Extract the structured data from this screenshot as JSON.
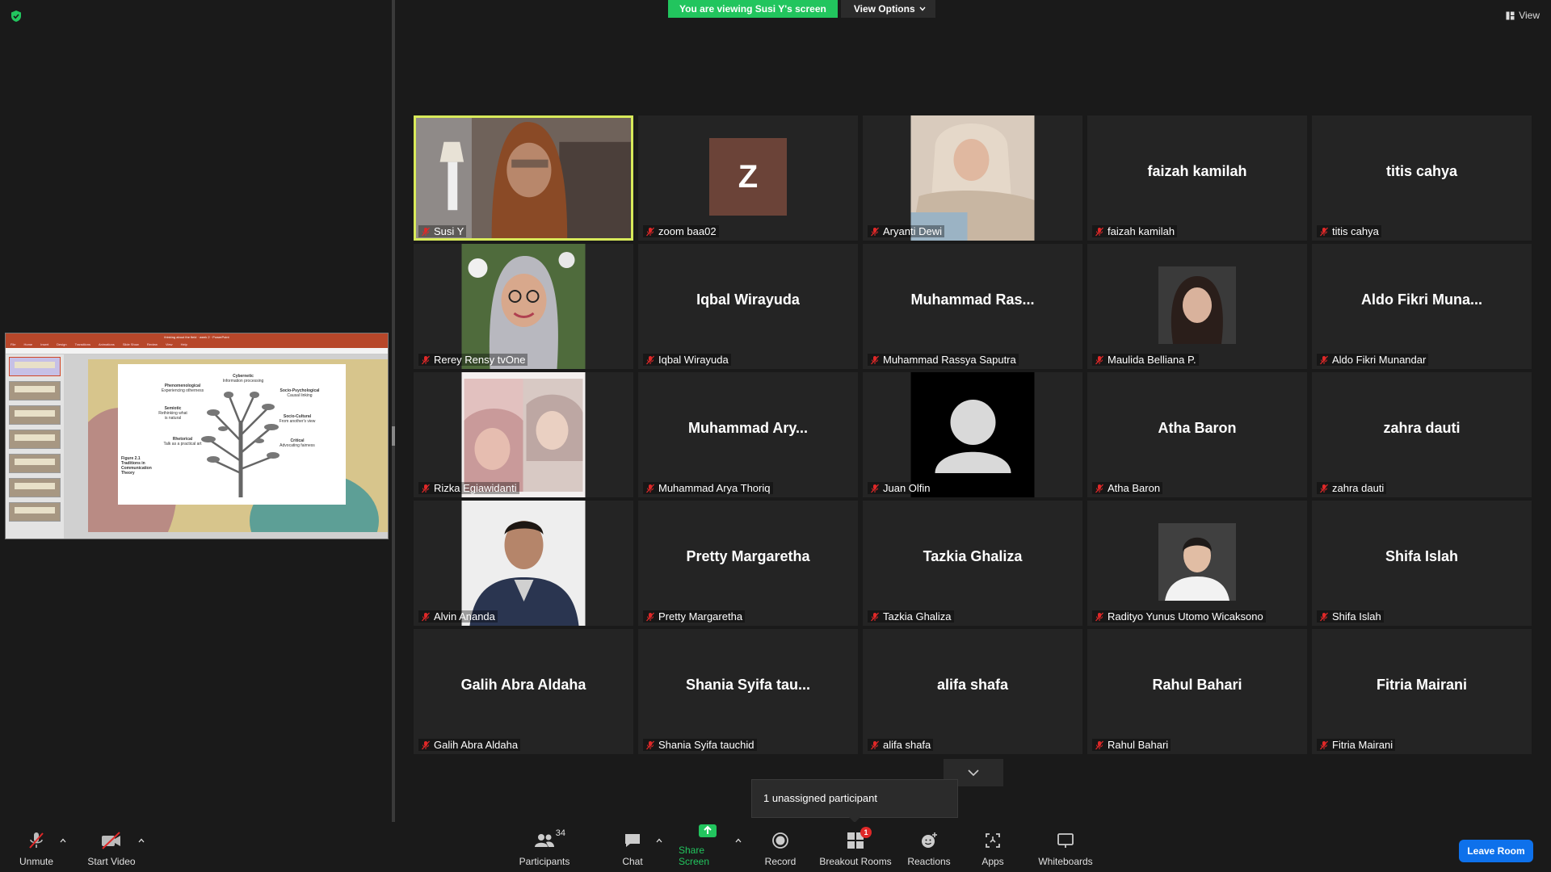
{
  "banner": {
    "viewing": "You are viewing Susi Y's screen",
    "view_options": "View Options"
  },
  "top_right": {
    "view": "View"
  },
  "presentation": {
    "window_title": "thinking about the field · week 2 · PowerPoint",
    "tabs": [
      "File",
      "Home",
      "Insert",
      "Design",
      "Transitions",
      "Animations",
      "Slide Show",
      "Review",
      "View",
      "Help"
    ],
    "slide_labels": [
      {
        "title": "Cybernetic",
        "sub": "Information processing"
      },
      {
        "title": "Phenomenological",
        "sub": "Experiencing otherness"
      },
      {
        "title": "Socio-Psychological",
        "sub": "Causal linking"
      },
      {
        "title": "Semiotic",
        "sub": "Rethinking what is natural"
      },
      {
        "title": "Socio-Cultural",
        "sub": "From another's view"
      },
      {
        "title": "Rhetorical",
        "sub": "Talk as a practical art"
      },
      {
        "title": "Critical",
        "sub": "Advocating fairness"
      }
    ],
    "figure_caption": "Figure 2.1 Traditions in Communication Theory"
  },
  "participants": [
    {
      "name": "Susi Y",
      "display": "",
      "kind": "video"
    },
    {
      "name": "zoom baa02",
      "display": "",
      "kind": "letter",
      "letter": "Z"
    },
    {
      "name": "Aryanti Dewi",
      "display": "",
      "kind": "photo"
    },
    {
      "name": "faizah kamilah",
      "display": "faizah kamilah",
      "kind": "name"
    },
    {
      "name": "titis cahya",
      "display": "titis cahya",
      "kind": "name"
    },
    {
      "name": "Rerey Rensy tvOne",
      "display": "",
      "kind": "photo"
    },
    {
      "name": "Iqbal Wirayuda",
      "display": "Iqbal Wirayuda",
      "kind": "name"
    },
    {
      "name": "Muhammad Rassya Saputra",
      "display": "Muhammad  Ras...",
      "kind": "name"
    },
    {
      "name": "Maulida Belliana P.",
      "display": "",
      "kind": "photo-small"
    },
    {
      "name": "Aldo Fikri Munandar",
      "display": "Aldo  Fikri  Muna...",
      "kind": "name"
    },
    {
      "name": "Rizka Egiawidanti",
      "display": "",
      "kind": "photo"
    },
    {
      "name": "Muhammad Arya Thoriq",
      "display": "Muhammad  Ary...",
      "kind": "name"
    },
    {
      "name": "Juan Olfin",
      "display": "",
      "kind": "default-avatar"
    },
    {
      "name": "Atha Baron",
      "display": "Atha Baron",
      "kind": "name"
    },
    {
      "name": "zahra dauti",
      "display": "zahra dauti",
      "kind": "name"
    },
    {
      "name": "Alvin Ananda",
      "display": "",
      "kind": "photo"
    },
    {
      "name": "Pretty Margaretha",
      "display": "Pretty Margaretha",
      "kind": "name"
    },
    {
      "name": "Tazkia Ghaliza",
      "display": "Tazkia Ghaliza",
      "kind": "name"
    },
    {
      "name": "Radityo Yunus Utomo Wicaksono",
      "display": "",
      "kind": "photo-small"
    },
    {
      "name": "Shifa Islah",
      "display": "Shifa Islah",
      "kind": "name"
    },
    {
      "name": "Galih Abra Aldaha",
      "display": "Galih Abra Aldaha",
      "kind": "name"
    },
    {
      "name": "Shania Syifa tauchid",
      "display": "Shania  Syifa  tau...",
      "kind": "name"
    },
    {
      "name": "alifa shafa",
      "display": "alifa shafa",
      "kind": "name"
    },
    {
      "name": "Rahul Bahari",
      "display": "Rahul Bahari",
      "kind": "name"
    },
    {
      "name": "Fitria Mairani",
      "display": "Fitria Mairani",
      "kind": "name"
    }
  ],
  "unassigned": "1 unassigned participant",
  "toolbar": {
    "unmute": "Unmute",
    "start_video": "Start Video",
    "participants": "Participants",
    "participants_count": "34",
    "chat": "Chat",
    "share_screen": "Share Screen",
    "record": "Record",
    "breakout_rooms": "Breakout Rooms",
    "breakout_badge": "1",
    "reactions": "Reactions",
    "apps": "Apps",
    "whiteboards": "Whiteboards",
    "leave": "Leave Room"
  },
  "colors": {
    "accent_green": "#22c55e",
    "active_speaker": "#d8ea5a",
    "leave_blue": "#0e71eb",
    "mute_red": "#e02828"
  }
}
